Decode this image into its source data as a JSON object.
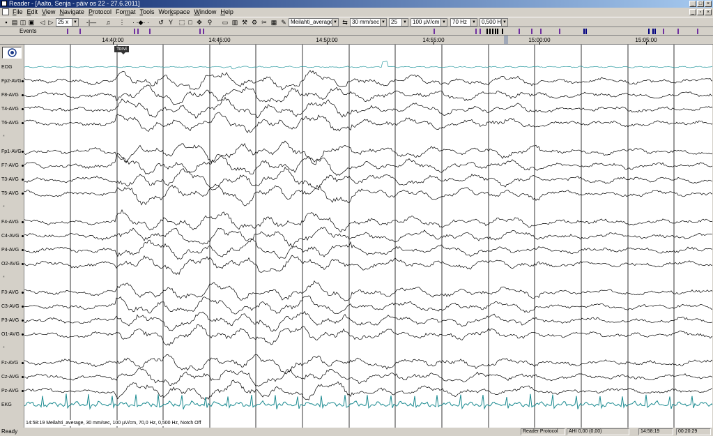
{
  "window": {
    "title": "Reader - [Aalto, Senja - päiv os 22 - 27.6.2011]"
  },
  "menu": {
    "items": [
      {
        "label": "File",
        "u": "F"
      },
      {
        "label": "Edit",
        "u": "E"
      },
      {
        "label": "View",
        "u": "V"
      },
      {
        "label": "Navigate",
        "u": "N"
      },
      {
        "label": "Protocol",
        "u": "P"
      },
      {
        "label": "Format",
        "u": "m"
      },
      {
        "label": "Tools",
        "u": "T"
      },
      {
        "label": "Workspace",
        "u": "k"
      },
      {
        "label": "Window",
        "u": "W"
      },
      {
        "label": "Help",
        "u": "H"
      }
    ]
  },
  "toolbar": {
    "zoom": "25 x",
    "montage": "Meilahti_average",
    "speed": "30 mm/sec",
    "page_value": "25",
    "sensitivity": "100 µV/cm",
    "high_filter": "70 Hz",
    "low_filter": "0,500 Hz"
  },
  "events": {
    "label": "Events",
    "marks": [
      {
        "t": 96,
        "c": "#7030a0"
      },
      {
        "t": 114,
        "c": "#7030a0"
      },
      {
        "t": 192,
        "c": "#7030a0"
      },
      {
        "t": 197,
        "c": "#7030a0"
      },
      {
        "t": 214,
        "c": "#7030a0"
      },
      {
        "t": 286,
        "c": "#7030a0"
      },
      {
        "t": 291,
        "c": "#7030a0"
      },
      {
        "t": 622,
        "c": "#7030a0"
      },
      {
        "t": 682,
        "c": "#7030a0"
      },
      {
        "t": 688,
        "c": "#7030a0"
      },
      {
        "t": 698,
        "c": "#000000"
      },
      {
        "t": 702,
        "c": "#000000"
      },
      {
        "t": 706,
        "c": "#000000"
      },
      {
        "t": 710,
        "c": "#000000"
      },
      {
        "t": 713,
        "c": "#000000"
      },
      {
        "t": 720,
        "c": "#000000"
      },
      {
        "t": 744,
        "c": "#7030a0"
      },
      {
        "t": 762,
        "c": "#7030a0"
      },
      {
        "t": 775,
        "c": "#7030a0"
      },
      {
        "t": 802,
        "c": "#7030a0"
      },
      {
        "t": 837,
        "c": "#000080"
      },
      {
        "t": 840,
        "c": "#000080"
      },
      {
        "t": 930,
        "c": "#000080"
      },
      {
        "t": 936,
        "c": "#000080"
      },
      {
        "t": 939,
        "c": "#000080"
      },
      {
        "t": 951,
        "c": "#7030a0"
      },
      {
        "t": 972,
        "c": "#7030a0"
      },
      {
        "t": 1000,
        "c": "#7030a0"
      }
    ]
  },
  "timeline": {
    "labels": [
      "14:40:00",
      "14:45:00",
      "14:50:00",
      "14:55:00",
      "15:00:00",
      "15:05:00"
    ],
    "cursor_time": "14:58:19"
  },
  "marker": {
    "label": "Torvi"
  },
  "channels": [
    {
      "label": "EOG",
      "color": "#2a9aa0",
      "amp": 2,
      "kind": "eog"
    },
    {
      "label": "Fp2-AVG",
      "color": "#000000",
      "amp": 9,
      "kind": "eeg"
    },
    {
      "label": "F8-AVG",
      "color": "#000000",
      "amp": 9,
      "kind": "eeg"
    },
    {
      "label": "T4-AVG",
      "color": "#000000",
      "amp": 9,
      "kind": "eeg"
    },
    {
      "label": "T6-AVG",
      "color": "#000000",
      "amp": 9,
      "kind": "eeg"
    },
    {
      "label": "*",
      "color": "",
      "amp": 0,
      "kind": "sep"
    },
    {
      "label": "Fp1-AVG",
      "color": "#000000",
      "amp": 10,
      "kind": "eeg"
    },
    {
      "label": "F7-AVG",
      "color": "#000000",
      "amp": 10,
      "kind": "eeg"
    },
    {
      "label": "T3-AVG",
      "color": "#000000",
      "amp": 10,
      "kind": "eeg"
    },
    {
      "label": "T5-AVG",
      "color": "#000000",
      "amp": 10,
      "kind": "eeg"
    },
    {
      "label": "*",
      "color": "",
      "amp": 0,
      "kind": "sep"
    },
    {
      "label": "F4-AVG",
      "color": "#000000",
      "amp": 9,
      "kind": "eeg"
    },
    {
      "label": "C4-AVG",
      "color": "#000000",
      "amp": 9,
      "kind": "eeg"
    },
    {
      "label": "P4-AVG",
      "color": "#000000",
      "amp": 9,
      "kind": "eeg"
    },
    {
      "label": "O2-AVG",
      "color": "#000000",
      "amp": 9,
      "kind": "eeg"
    },
    {
      "label": "*",
      "color": "",
      "amp": 0,
      "kind": "sep"
    },
    {
      "label": "F3-AVG",
      "color": "#000000",
      "amp": 9,
      "kind": "eeg"
    },
    {
      "label": "C3-AVG",
      "color": "#000000",
      "amp": 9,
      "kind": "eeg"
    },
    {
      "label": "P3-AVG",
      "color": "#000000",
      "amp": 9,
      "kind": "eeg"
    },
    {
      "label": "O1-AVG",
      "color": "#000000",
      "amp": 9,
      "kind": "eeg"
    },
    {
      "label": "*",
      "color": "",
      "amp": 0,
      "kind": "sep"
    },
    {
      "label": "Fz-AVG",
      "color": "#000000",
      "amp": 9,
      "kind": "eeg"
    },
    {
      "label": "Cz-AVG",
      "color": "#000000",
      "amp": 9,
      "kind": "eeg"
    },
    {
      "label": "Pz-AVG",
      "color": "#000000",
      "amp": 9,
      "kind": "eeg"
    },
    {
      "label": "EKG",
      "color": "#1a8a90",
      "amp": 10,
      "kind": "ekg"
    }
  ],
  "info": {
    "text": "14:58:19 Meilahti_average, 30 mm/sec, 100 µV/cm, 70,0 Hz, 0,500 Hz, Notch Off"
  },
  "status": {
    "ready": "Ready",
    "protocol": "Reader Protocol",
    "ahi": "AHI 0,00 (0,00)",
    "time": "14:58:19",
    "elapsed": "00:20:29"
  }
}
